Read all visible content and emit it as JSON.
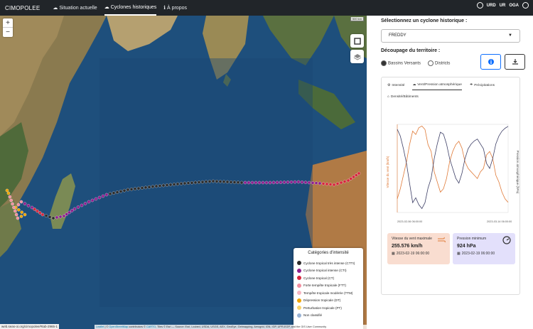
{
  "app": {
    "brand": "CIMOPOLEE"
  },
  "nav": [
    {
      "label": "Situation actuelle",
      "icon": "cloud-icon"
    },
    {
      "label": "Cyclones historiques",
      "icon": "history-icon",
      "active": true
    },
    {
      "label": "À propos",
      "icon": "info-icon"
    }
  ],
  "logos": [
    "URD",
    "UR",
    "OGA"
  ],
  "map": {
    "scale": "500 km",
    "attribution_link1": "Leaflet",
    "attribution_mid": " | © ",
    "attribution_link2": "OpenStreetMap",
    "attribution_mid2": " contributors © ",
    "attribution_link3": "CARTO",
    "attribution_rest": ", Tiles © Esri — Source: Esri, i-cubed, USDA, USGS, AEX, GeoEye, Getmapping, Aerogrid, IGN, IGP, UPR-EGP, and the GIS User Community",
    "url": "web.seas-oi.org/cimopolee/#tab-2965-1"
  },
  "legend": {
    "title": "Catégories d'intensité",
    "items": [
      {
        "label": "Cyclone tropical très intense (CTTI)",
        "color": "#2b2b2b"
      },
      {
        "label": "Cyclone tropical intense (CTI)",
        "color": "#8e1f8e"
      },
      {
        "label": "Cyclone tropical (CT)",
        "color": "#d7263d"
      },
      {
        "label": "Forte tempête tropicale (FTT)",
        "color": "#f28fa0"
      },
      {
        "label": "Tempête tropicale modérée (TTM)",
        "color": "#f7b6c2"
      },
      {
        "label": "Dépression tropicale (DT)",
        "color": "#f0a500"
      },
      {
        "label": "Perturbation tropicale (PT)",
        "color": "#f8d36b"
      },
      {
        "label": "Non classifié",
        "color": "#9ab3d5"
      }
    ]
  },
  "panel": {
    "select_label": "Sélectionnez un cyclone historique :",
    "select_value": "FREDDY",
    "territory_label": "Découpage du territoire :",
    "radio1": "Bassins Versants",
    "radio2": "Districts",
    "tabs": [
      "Intensité",
      "Vent/Pression atmosphérique",
      "Précipitations"
    ],
    "tab_second": "Densité/Bâtiments",
    "chart_left_label": "Vitesse du vent (km/h)",
    "chart_right_label": "Pression atmosphérique (hPa)",
    "x_start": "2023-02-06 06:00:00",
    "x_end": "2023-03-14 06:00:00",
    "stat1": {
      "title": "Vitesse du vent maximale",
      "value": "255.576 km/h",
      "date": "2023-02-19 06:00:00"
    },
    "stat2": {
      "title": "Pression minimum",
      "value": "924 hPa",
      "date": "2023-02-19 06:00:00"
    }
  },
  "chart_data": {
    "type": "line",
    "x": [
      0,
      1,
      2,
      3,
      4,
      5,
      6,
      7,
      8,
      9,
      10,
      11,
      12,
      13,
      14,
      15,
      16,
      17,
      18,
      19,
      20,
      21,
      22,
      23,
      24,
      25,
      26,
      27,
      28,
      29,
      30,
      31,
      32,
      33,
      34,
      35,
      36
    ],
    "series": [
      {
        "name": "Vitesse du vent",
        "axis": "left",
        "values": [
          40,
          70,
          110,
          150,
          200,
          240,
          230,
          250,
          255,
          245,
          200,
          180,
          120,
          90,
          60,
          70,
          100,
          150,
          180,
          200,
          210,
          190,
          150,
          130,
          120,
          110,
          100,
          120,
          130,
          170,
          180,
          160,
          110,
          90,
          60,
          40,
          30
        ]
      },
      {
        "name": "Pression atmosphérique",
        "axis": "right",
        "values": [
          1005,
          998,
          985,
          970,
          950,
          930,
          935,
          928,
          924,
          930,
          945,
          955,
          975,
          990,
          1002,
          1000,
          990,
          975,
          965,
          955,
          950,
          960,
          975,
          985,
          990,
          993,
          995,
          990,
          985,
          970,
          965,
          975,
          990,
          998,
          1003,
          1006,
          1008
        ]
      }
    ],
    "ylim_left": [
      0,
      260
    ],
    "ylim_right": [
      920,
      1010
    ]
  }
}
